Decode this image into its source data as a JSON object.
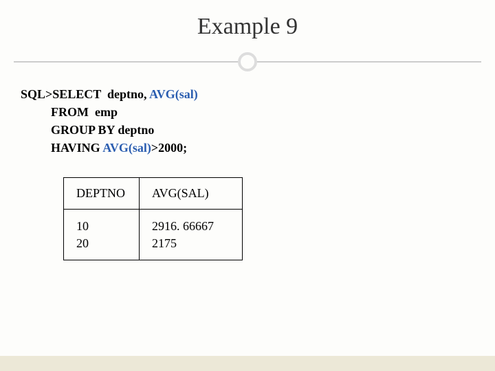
{
  "title": "Example 9",
  "sql": {
    "prompt": "SQL>",
    "line1_a": "SELECT  deptno, ",
    "line1_fn": "AVG(sal)",
    "line2": "FROM  emp",
    "line3": "GROUP BY deptno",
    "line4_a": "HAVING ",
    "line4_fn": "AVG(sal)",
    "line4_b": ">2000;"
  },
  "chart_data": {
    "type": "table",
    "columns": [
      "DEPTNO",
      "AVG(SAL)"
    ],
    "rows": [
      {
        "deptno": "10",
        "avg_sal": "2916. 66667"
      },
      {
        "deptno": "20",
        "avg_sal": "2175"
      }
    ]
  }
}
